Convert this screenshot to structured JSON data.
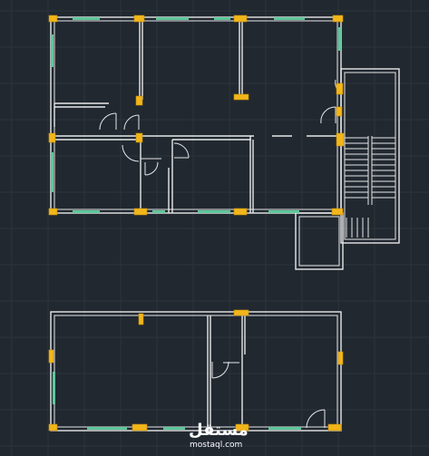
{
  "drawing": {
    "background_color": "#212830",
    "grid_color": "#2e3742",
    "wall_color": "#e8e8e8",
    "column_color": "#f2b61a",
    "window_color": "#5fc79b"
  },
  "watermark": {
    "brand_arabic": "مستقل",
    "brand_latin": "mostaql.com"
  }
}
